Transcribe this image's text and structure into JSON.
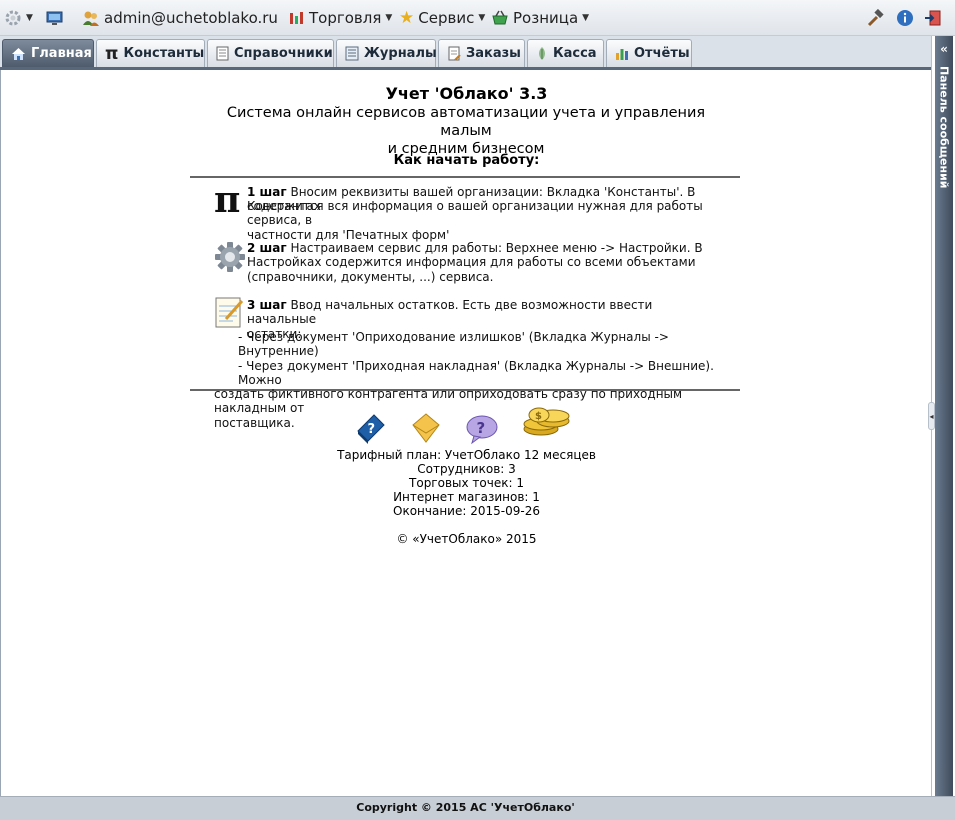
{
  "topbar": {
    "user": "admin@uchetoblako.ru",
    "menus": [
      {
        "label": "Торговля"
      },
      {
        "label": "Сервис"
      },
      {
        "label": "Розница"
      }
    ]
  },
  "tabs": [
    {
      "label": "Главная",
      "icon": "home-icon",
      "active": true
    },
    {
      "label": "Константы",
      "icon": "pi-icon",
      "active": false
    },
    {
      "label": "Справочники",
      "icon": "book-icon",
      "active": false
    },
    {
      "label": "Журналы",
      "icon": "journal-icon",
      "active": false
    },
    {
      "label": "Заказы",
      "icon": "orders-icon",
      "active": false
    },
    {
      "label": "Касса",
      "icon": "cash-icon",
      "active": false
    },
    {
      "label": "Отчёты",
      "icon": "reports-icon",
      "active": false
    }
  ],
  "panel": {
    "title": "Панель сообщений"
  },
  "main": {
    "title": "Учет 'Облако' 3.3",
    "subtitle_line1": "Система онлайн сервисов автоматизации учета и управления малым",
    "subtitle_line2": "и средним бизнесом",
    "howto": "Как начать работу:",
    "steps": [
      {
        "label": "1 шаг",
        "lines": [
          "Вносим реквизиты вашей организации: Вкладка 'Константы'. В Константах",
          "содержится вся информация о вашей организации нужная для работы сервиса, в",
          "частности для 'Печатных форм'"
        ]
      },
      {
        "label": "2 шаг",
        "lines": [
          "Настраиваем сервис для работы: Верхнее меню -> Настройки. В",
          "Настройках содержится информация для работы со всеми объектами",
          "(справочники, документы, ...) сервиса."
        ]
      },
      {
        "label": "3 шаг",
        "lines": [
          "Ввод начальных остатков. Есть две возможности ввести начальные",
          "остатки:",
          "- Через документ 'Оприходование излишков' (Вкладка Журналы -> Внутренние)",
          "- Через документ 'Приходная накладная' (Вкладка Журналы -> Внешние). Можно",
          "создать фиктивного контрагента или оприходовать сразу по приходным накладным от",
          "поставщика."
        ]
      }
    ],
    "info": [
      "Тарифный план: УчетОблако 12 месяцев",
      "Сотрудников: 3",
      "Торговых точек: 1",
      "Интернет магазинов: 1",
      "Окончание: 2015-09-26"
    ],
    "copyright": "© «УчетОблако» 2015"
  },
  "footer": {
    "text": "Copyright © 2015 АС 'УчетОблако'"
  },
  "colors": {
    "active_tab": "#5a687b",
    "tab_border": "#59677a",
    "panel": "#4b5a6c"
  }
}
